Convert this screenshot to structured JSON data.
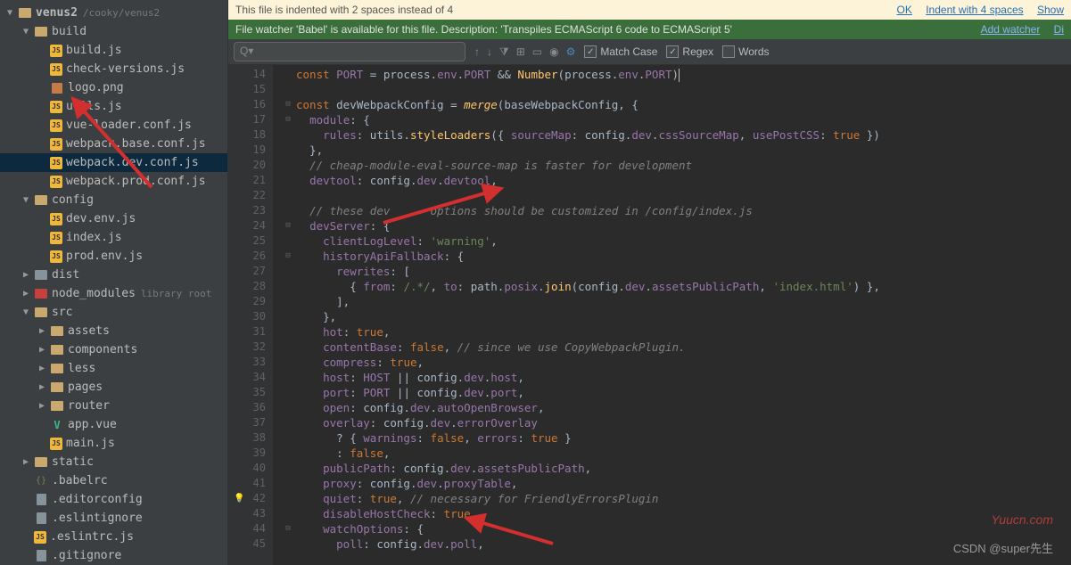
{
  "sidebar": {
    "root": {
      "label": "venus2",
      "path": "/cooky/venus2"
    },
    "items": [
      {
        "indent": 1,
        "arrow": "▼",
        "icon": "folder",
        "label": "build"
      },
      {
        "indent": 2,
        "arrow": "",
        "icon": "js",
        "label": "build.js"
      },
      {
        "indent": 2,
        "arrow": "",
        "icon": "js",
        "label": "check-versions.js"
      },
      {
        "indent": 2,
        "arrow": "",
        "icon": "png",
        "label": "logo.png"
      },
      {
        "indent": 2,
        "arrow": "",
        "icon": "js",
        "label": "utils.js"
      },
      {
        "indent": 2,
        "arrow": "",
        "icon": "js",
        "label": "vue-loader.conf.js"
      },
      {
        "indent": 2,
        "arrow": "",
        "icon": "js",
        "label": "webpack.base.conf.js"
      },
      {
        "indent": 2,
        "arrow": "",
        "icon": "js",
        "label": "webpack.dev.conf.js",
        "selected": true
      },
      {
        "indent": 2,
        "arrow": "",
        "icon": "js",
        "label": "webpack.prod.conf.js"
      },
      {
        "indent": 1,
        "arrow": "▼",
        "icon": "folder",
        "label": "config"
      },
      {
        "indent": 2,
        "arrow": "",
        "icon": "js",
        "label": "dev.env.js"
      },
      {
        "indent": 2,
        "arrow": "",
        "icon": "js",
        "label": "index.js"
      },
      {
        "indent": 2,
        "arrow": "",
        "icon": "js",
        "label": "prod.env.js"
      },
      {
        "indent": 1,
        "arrow": "▶",
        "icon": "folder-grey",
        "label": "dist"
      },
      {
        "indent": 1,
        "arrow": "▶",
        "icon": "folder-red",
        "label": "node_modules",
        "extra": "library root"
      },
      {
        "indent": 1,
        "arrow": "▼",
        "icon": "folder",
        "label": "src"
      },
      {
        "indent": 2,
        "arrow": "▶",
        "icon": "folder",
        "label": "assets"
      },
      {
        "indent": 2,
        "arrow": "▶",
        "icon": "folder",
        "label": "components"
      },
      {
        "indent": 2,
        "arrow": "▶",
        "icon": "folder",
        "label": "less"
      },
      {
        "indent": 2,
        "arrow": "▶",
        "icon": "folder",
        "label": "pages"
      },
      {
        "indent": 2,
        "arrow": "▶",
        "icon": "folder",
        "label": "router"
      },
      {
        "indent": 2,
        "arrow": "",
        "icon": "vue",
        "label": "app.vue"
      },
      {
        "indent": 2,
        "arrow": "",
        "icon": "js",
        "label": "main.js"
      },
      {
        "indent": 1,
        "arrow": "▶",
        "icon": "folder",
        "label": "static"
      },
      {
        "indent": 1,
        "arrow": "",
        "icon": "json",
        "label": ".babelrc"
      },
      {
        "indent": 1,
        "arrow": "",
        "icon": "file",
        "label": ".editorconfig"
      },
      {
        "indent": 1,
        "arrow": "",
        "icon": "file",
        "label": ".eslintignore"
      },
      {
        "indent": 1,
        "arrow": "",
        "icon": "js",
        "label": ".eslintrc.js"
      },
      {
        "indent": 1,
        "arrow": "",
        "icon": "file",
        "label": ".gitignore"
      }
    ]
  },
  "banner_indent": {
    "text": "This file is indented with 2 spaces instead of 4",
    "link1": "OK",
    "link2": "Indent with 4 spaces",
    "link3": "Show"
  },
  "banner_watcher": {
    "text": "File watcher 'Babel' is available for this file. Description: 'Transpiles ECMAScript 6 code to ECMAScript 5'",
    "link1": "Add watcher",
    "link2": "Di"
  },
  "findbar": {
    "placeholder": "Q▾",
    "match_case": "Match Case",
    "regex": "Regex",
    "words": "Words"
  },
  "line_numbers": [
    14,
    15,
    16,
    17,
    18,
    19,
    20,
    21,
    22,
    23,
    24,
    25,
    26,
    27,
    28,
    29,
    30,
    31,
    32,
    33,
    34,
    35,
    36,
    37,
    38,
    39,
    40,
    41,
    42,
    43,
    44,
    45
  ],
  "code": {
    "l14": [
      "const ",
      "PORT",
      " = process.",
      "env",
      ".",
      "PORT",
      " && ",
      "Number",
      "(process.",
      "env",
      ".",
      "PORT",
      ")"
    ],
    "l16": [
      "const ",
      "devWebpackConfig",
      " = ",
      "merge",
      "(",
      "baseWebpackConfig",
      ", {"
    ],
    "l17": [
      "  ",
      "module",
      ": {"
    ],
    "l18": [
      "    ",
      "rules",
      ": utils.",
      "styleLoaders",
      "({ ",
      "sourceMap",
      ": config.",
      "dev",
      ".",
      "cssSourceMap",
      ", ",
      "usePostCSS",
      ": ",
      "true",
      " })"
    ],
    "l19": [
      "  },"
    ],
    "l20": [
      "  ",
      "// cheap-module-eval-source-map is faster for development"
    ],
    "l21": [
      "  ",
      "devtool",
      ": config.",
      "dev",
      ".",
      "devtool",
      ","
    ],
    "l23": [
      "  ",
      "// these dev      options should be customized in /config/index.js"
    ],
    "l24": [
      "  ",
      "devServer",
      ": {"
    ],
    "l25": [
      "    ",
      "clientLogLevel",
      ": ",
      "'warning'",
      ","
    ],
    "l26": [
      "    ",
      "historyApiFallback",
      ": {"
    ],
    "l27": [
      "      ",
      "rewrites",
      ": ["
    ],
    "l28": [
      "        { ",
      "from",
      ": ",
      "/.*/",
      ",",
      " to",
      ": path.",
      "posix",
      ".",
      "join",
      "(config.",
      "dev",
      ".",
      "assetsPublicPath",
      ", ",
      "'index.html'",
      ") },"
    ],
    "l29": [
      "      ],"
    ],
    "l30": [
      "    },"
    ],
    "l31": [
      "    ",
      "hot",
      ": ",
      "true",
      ","
    ],
    "l32": [
      "    ",
      "contentBase",
      ": ",
      "false",
      ", ",
      "// since we use CopyWebpackPlugin."
    ],
    "l33": [
      "    ",
      "compress",
      ": ",
      "true",
      ","
    ],
    "l34": [
      "    ",
      "host",
      ": ",
      "HOST",
      " || config.",
      "dev",
      ".",
      "host",
      ","
    ],
    "l35": [
      "    ",
      "port",
      ": ",
      "PORT",
      " || config.",
      "dev",
      ".",
      "port",
      ","
    ],
    "l36": [
      "    ",
      "open",
      ": config.",
      "dev",
      ".",
      "autoOpenBrowser",
      ","
    ],
    "l37": [
      "    ",
      "overlay",
      ": config.",
      "dev",
      ".",
      "errorOverlay"
    ],
    "l38": [
      "      ? { ",
      "warnings",
      ": ",
      "false",
      ", ",
      "errors",
      ": ",
      "true",
      " }"
    ],
    "l39": [
      "      : ",
      "false",
      ","
    ],
    "l40": [
      "    ",
      "publicPath",
      ": config.",
      "dev",
      ".",
      "assetsPublicPath",
      ","
    ],
    "l41": [
      "    ",
      "proxy",
      ": config.",
      "dev",
      ".",
      "proxyTable",
      ","
    ],
    "l42": [
      "    ",
      "quiet",
      ": ",
      "true",
      ", ",
      "// necessary for FriendlyErrorsPlugin"
    ],
    "l43": [
      "    ",
      "disableHostCheck",
      ": ",
      "true",
      ","
    ],
    "l44": [
      "    ",
      "watchOptions",
      ": {"
    ],
    "l45": [
      "      ",
      "poll",
      ": config.",
      "dev",
      ".",
      "poll",
      ","
    ]
  },
  "watermark1": "Yuucn.com",
  "watermark2": "CSDN @super先生"
}
